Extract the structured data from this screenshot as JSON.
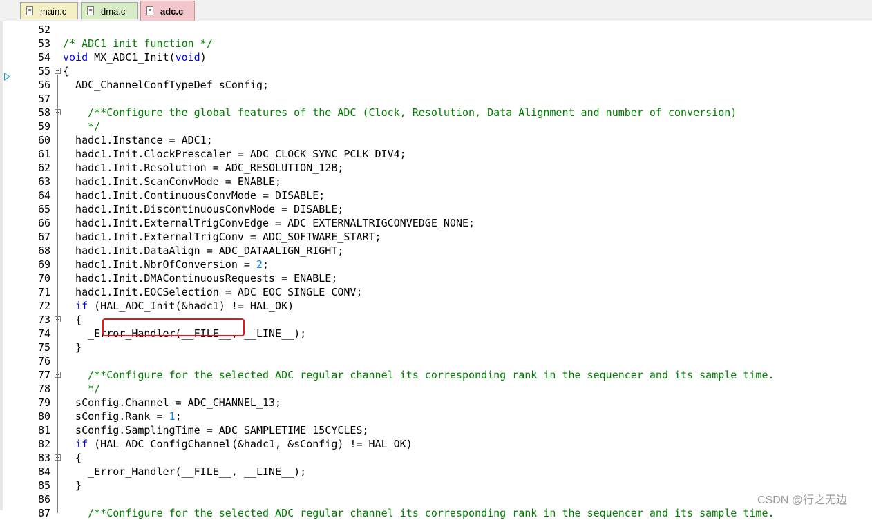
{
  "tabs": [
    {
      "label": "main.c"
    },
    {
      "label": "dma.c"
    },
    {
      "label": "adc.c",
      "active": true
    }
  ],
  "lines": [
    {
      "n": "52",
      "html": ""
    },
    {
      "n": "53",
      "html": "<span class=\"cm\">/* ADC1 init function */</span>"
    },
    {
      "n": "54",
      "html": "<span class=\"kw\">void</span> MX_ADC1_Init(<span class=\"kw\">void</span>)"
    },
    {
      "n": "55",
      "html": "{"
    },
    {
      "n": "56",
      "html": "  ADC_ChannelConfTypeDef sConfig;"
    },
    {
      "n": "57",
      "html": ""
    },
    {
      "n": "58",
      "html": "    <span class=\"cm\">/**Configure the global features of the ADC (Clock, Resolution, Data Alignment and number of conversion)</span>"
    },
    {
      "n": "59",
      "html": "    <span class=\"cm\">*/</span>"
    },
    {
      "n": "60",
      "html": "  hadc1.Instance = ADC1;"
    },
    {
      "n": "61",
      "html": "  hadc1.Init.ClockPrescaler = ADC_CLOCK_SYNC_PCLK_DIV4;"
    },
    {
      "n": "62",
      "html": "  hadc1.Init.Resolution = ADC_RESOLUTION_12B;"
    },
    {
      "n": "63",
      "html": "  hadc1.Init.ScanConvMode = ENABLE;"
    },
    {
      "n": "64",
      "html": "  hadc1.Init.ContinuousConvMode = DISABLE;"
    },
    {
      "n": "65",
      "html": "  hadc1.Init.DiscontinuousConvMode = DISABLE;"
    },
    {
      "n": "66",
      "html": "  hadc1.Init.ExternalTrigConvEdge = ADC_EXTERNALTRIGCONVEDGE_NONE;"
    },
    {
      "n": "67",
      "html": "  hadc1.Init.ExternalTrigConv = ADC_SOFTWARE_START;"
    },
    {
      "n": "68",
      "html": "  hadc1.Init.DataAlign = ADC_DATAALIGN_RIGHT;"
    },
    {
      "n": "69",
      "html": "  hadc1.Init.NbrOfConversion = <span class=\"num\">2</span>;"
    },
    {
      "n": "70",
      "html": "  hadc1.Init.DMAContinuousRequests = ENABLE;"
    },
    {
      "n": "71",
      "html": "  hadc1.Init.EOCSelection = ADC_EOC_SINGLE_CONV;"
    },
    {
      "n": "72",
      "html": "  <span class=\"kw\">if</span> (HAL_ADC_Init(&amp;hadc1) != HAL_OK)"
    },
    {
      "n": "73",
      "html": "  {"
    },
    {
      "n": "74",
      "html": "    _Error_Handler(__FILE__, __LINE__);"
    },
    {
      "n": "75",
      "html": "  }"
    },
    {
      "n": "76",
      "html": ""
    },
    {
      "n": "77",
      "html": "    <span class=\"cm\">/**Configure for the selected ADC regular channel its corresponding rank in the sequencer and its sample time.</span>"
    },
    {
      "n": "78",
      "html": "    <span class=\"cm\">*/</span>"
    },
    {
      "n": "79",
      "html": "  sConfig.Channel = ADC_CHANNEL_13;"
    },
    {
      "n": "80",
      "html": "  sConfig.Rank = <span class=\"num\">1</span>;"
    },
    {
      "n": "81",
      "html": "  sConfig.SamplingTime = ADC_SAMPLETIME_15CYCLES;"
    },
    {
      "n": "82",
      "html": "  <span class=\"kw\">if</span> (HAL_ADC_ConfigChannel(&amp;hadc1, &amp;sConfig) != HAL_OK)"
    },
    {
      "n": "83",
      "html": "  {"
    },
    {
      "n": "84",
      "html": "    _Error_Handler(__FILE__, __LINE__);"
    },
    {
      "n": "85",
      "html": "  }"
    },
    {
      "n": "86",
      "html": ""
    },
    {
      "n": "87",
      "html": "    <span class=\"cm\">/**Configure for the selected ADC regular channel its corresponding rank in the sequencer and its sample time.</span>"
    }
  ],
  "fold_markers": [
    "55",
    "58",
    "73",
    "77",
    "83"
  ],
  "current_line": "54",
  "watermark": "CSDN @行之无边",
  "colors": {
    "keyword": "#0000ff",
    "comment": "#008000",
    "number": "#0080ff",
    "highlight_box": "#e8141a",
    "arrow": "#19a3c4"
  }
}
